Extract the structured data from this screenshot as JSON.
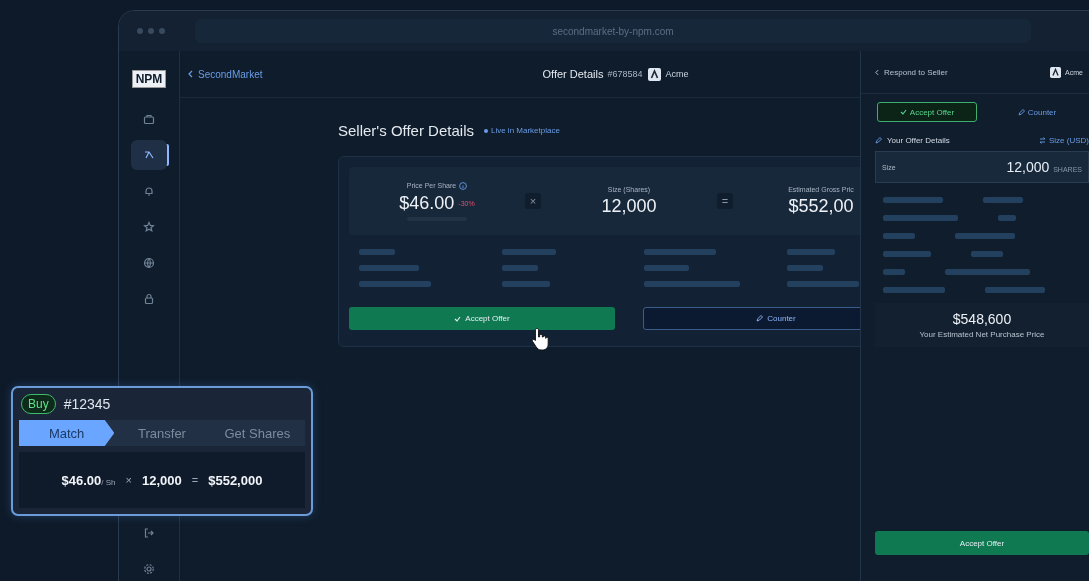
{
  "browser": {
    "url": "secondmarket-by-npm.com"
  },
  "sidebar": {
    "logo": "NPM",
    "items": [
      {
        "kind": "briefcase",
        "selected": false
      },
      {
        "kind": "tool",
        "selected": true
      },
      {
        "kind": "bell",
        "selected": false
      },
      {
        "kind": "star",
        "selected": false
      },
      {
        "kind": "globe",
        "selected": false
      },
      {
        "kind": "lock",
        "selected": false
      }
    ],
    "bottom_items": [
      {
        "kind": "logout",
        "selected": false
      },
      {
        "kind": "gear",
        "selected": false
      }
    ]
  },
  "header": {
    "back_link": "SecondMarket",
    "title": "Offer Details",
    "offer_number": "#678584",
    "company": "Acme"
  },
  "main": {
    "title": "Seller's Offer Details",
    "status": "Live in Marketplace",
    "metrics": [
      {
        "label": "Price Per Share",
        "value": "$46.00",
        "change": "-30%"
      },
      {
        "operator": "×",
        "label": "Size (Shares)",
        "value": "12,000"
      },
      {
        "operator": "=",
        "label": "Estimated Gross Pric",
        "value": "$552,00"
      }
    ],
    "buttons": [
      {
        "kind": "accept",
        "label": "Accept Offer"
      },
      {
        "kind": "counter",
        "label": "Counter"
      }
    ]
  },
  "panel": {
    "back_link": "Respond to Seller",
    "company": "Acme",
    "tabs": [
      {
        "label": "Accept Offer",
        "selected": true
      },
      {
        "label": "Counter",
        "selected": false
      }
    ],
    "section_title": "Your Offer Details",
    "toggle": "Size (USD)",
    "field": {
      "label": "Size",
      "value": "12,000",
      "unit": "SHARES"
    },
    "net_amount": "$548,600",
    "net_label": "Your Estimated Net Purchase Price",
    "submit": "Accept Offer"
  },
  "overlay": {
    "badge": "Buy",
    "order": "#12345",
    "steps": [
      {
        "label": "Match",
        "selected": true
      },
      {
        "label": "Transfer",
        "selected": false
      },
      {
        "label": "Get Shares",
        "selected": false
      }
    ],
    "price": "$46.00",
    "price_unit": "/ Sh",
    "times": "×",
    "size": "12,000",
    "equals": "=",
    "total": "$552,000"
  }
}
